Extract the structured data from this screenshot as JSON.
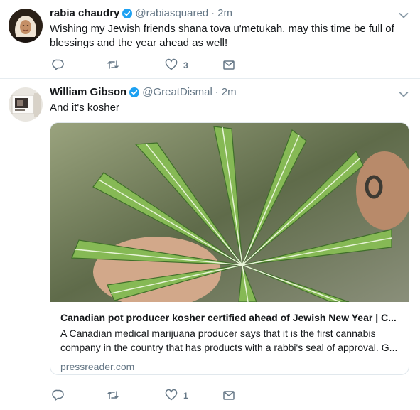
{
  "colors": {
    "text": "#14171a",
    "secondary": "#657786",
    "verified": "#1da1f2",
    "divider": "#e6ecf0"
  },
  "tweets": [
    {
      "name": "rabia chaudry",
      "handle": "@rabiasquared",
      "time": "2m",
      "text": "Wishing my Jewish friends shana tova u'metukah, may this time be full of blessings and the year ahead as well!",
      "reply_count": "",
      "retweet_count": "",
      "like_count": "3",
      "icons": [
        "reply-icon",
        "retweet-icon",
        "like-icon",
        "direct-message-icon",
        "chevron-down-icon",
        "verified-badge-icon"
      ]
    },
    {
      "name": "William Gibson",
      "handle": "@GreatDismal",
      "time": "2m",
      "text": "And it's kosher",
      "reply_count": "",
      "retweet_count": "",
      "like_count": "1",
      "card": {
        "title": "Canadian pot producer kosher certified ahead of Jewish New Year | C...",
        "description_line1": "A Canadian medical marijuana producer says that it is the first cannabis",
        "description_line2": "company in the country that has products with a rabbi's seal of approval. G...",
        "domain": "pressreader.com"
      }
    }
  ],
  "separator": "·"
}
